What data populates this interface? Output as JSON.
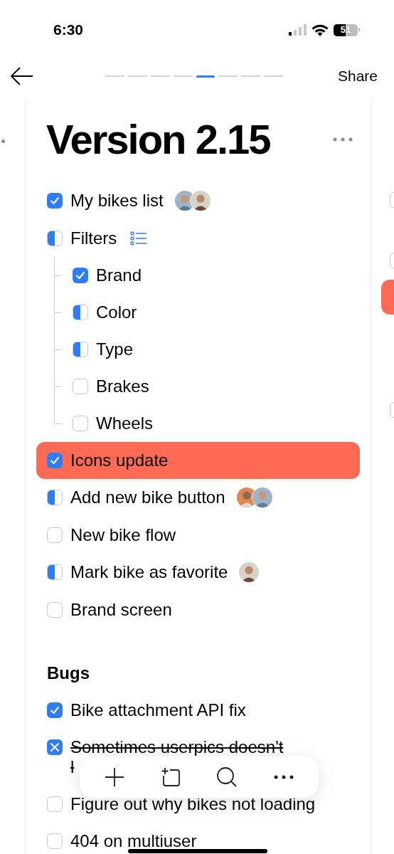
{
  "status_bar": {
    "time": "6:30",
    "battery": "51"
  },
  "nav": {
    "share": "Share",
    "pages": [
      {
        "selected": false
      },
      {
        "selected": false
      },
      {
        "selected": false
      },
      {
        "selected": false
      },
      {
        "selected": true
      },
      {
        "selected": false
      },
      {
        "selected": false
      },
      {
        "selected": false
      }
    ]
  },
  "next_page": {
    "rows": [
      {
        "checked": false
      },
      {
        "checked": false
      },
      {
        "highlighted": true
      },
      {
        "checked": false
      }
    ]
  },
  "page": {
    "title": "Version 2.15",
    "sections": [
      {
        "items": [
          {
            "text": "My bikes list",
            "kind": "done",
            "highlighted": false
          },
          {
            "text": "Filters",
            "kind": "partial",
            "highlighted": false,
            "list_icon": true,
            "children": [
              {
                "text": "Brand",
                "kind": "done"
              },
              {
                "text": "Color",
                "kind": "partial"
              },
              {
                "text": "Type",
                "kind": "partial"
              },
              {
                "text": "Brakes",
                "kind": "open"
              },
              {
                "text": "Wheels",
                "kind": "open"
              }
            ]
          },
          {
            "text": "Icons update",
            "kind": "done",
            "highlighted": true
          },
          {
            "text": "Add new bike button",
            "kind": "partial",
            "highlighted": false
          },
          {
            "text": "New bike flow",
            "kind": "open",
            "highlighted": false
          },
          {
            "text": "Mark bike as favorite",
            "kind": "partial",
            "highlighted": false
          },
          {
            "text": "Brand screen",
            "kind": "open",
            "highlighted": false
          }
        ]
      },
      {
        "heading": "Bugs",
        "items": [
          {
            "text": "Bike attachment API fix",
            "kind": "done",
            "highlighted": false
          },
          {
            "text": "Sometimes userpics doesn't l",
            "kind": "cancelled",
            "highlighted": false
          },
          {
            "text": "Figure out why bikes not loading",
            "kind": "open",
            "highlighted": false
          },
          {
            "text": "404 on multiuser",
            "kind": "open",
            "highlighted": false
          }
        ]
      }
    ]
  }
}
